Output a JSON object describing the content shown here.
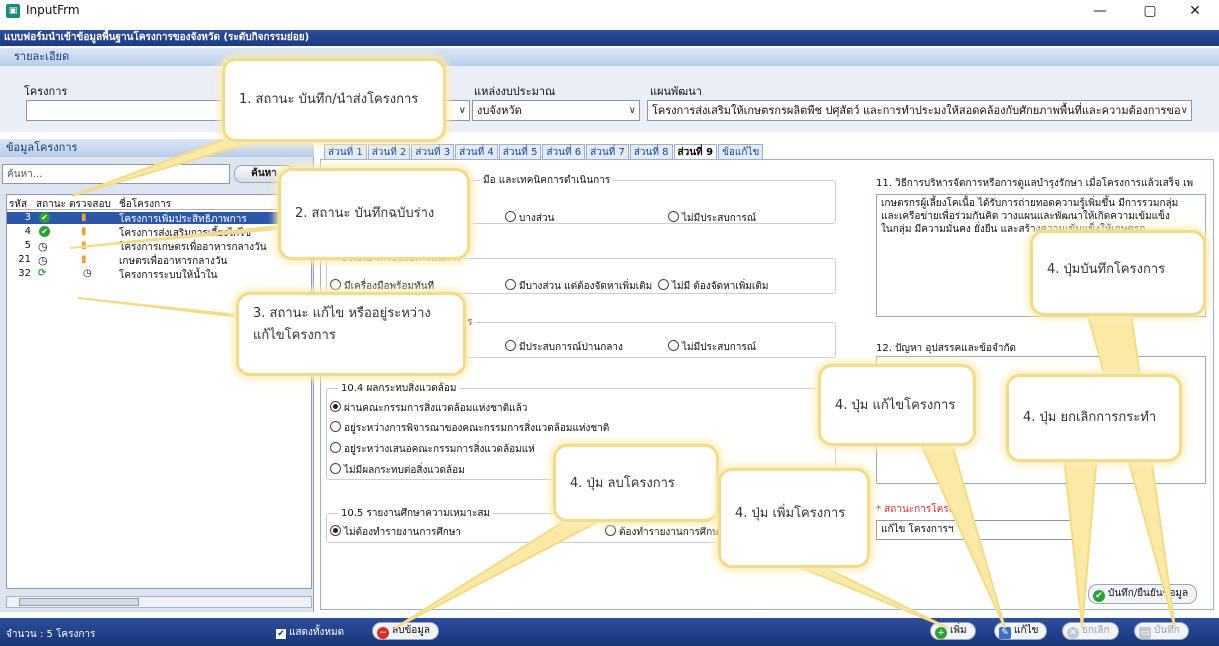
{
  "window": {
    "title": "InputFrm",
    "minimize": "—",
    "maximize": "▢",
    "close": "✕"
  },
  "form_header": "แบบฟอร์มนำเข้าข้อมูลพื้นฐานโครงการของจังหวัด (ระดับกิจกรรมย่อย)",
  "detail": {
    "header": "รายละเอียด",
    "project_label": "โครงการ",
    "project_value": "",
    "budget_source_label": "แหล่งงบประมาณ",
    "budget_source_value": "งบจังหวัด",
    "plan_label": "แผนพัฒนา",
    "plan_value": "โครงการส่งเสริมให้เกษตรกรผลิตพืช ปศุสัตว์ และการทำประมงให้สอดคล้องกับศักยภาพพื้นที่และความต้องการขอ"
  },
  "left_panel": {
    "header": "ข้อมูลโครงการ",
    "search_placeholder": "ค้นหา...",
    "search_button": "ค้นหา",
    "columns": [
      "รหัส",
      "สถานะ",
      "ตรวจสอบ",
      "ชื่อโครงการ"
    ],
    "rows": [
      {
        "id": "3",
        "status": "saved",
        "name": "โครงการเพิ่มประสิทธิภาพการ"
      },
      {
        "id": "4",
        "status": "saved",
        "name": "โครงการส่งเสริมการเลี้ยงไก่ไข่"
      },
      {
        "id": "5",
        "status": "draft",
        "name": "โครงการเกษตรเพื่ออาหารกลางวัน"
      },
      {
        "id": "21",
        "status": "draft",
        "name": "เกษตรเพื่ออาหารกลางวัน"
      },
      {
        "id": "32",
        "status": "editing",
        "name": "โครงการระบบให้น้ำใน"
      }
    ],
    "count_text": "จำนวน : 5 โครงการ",
    "show_all": "แสดงทั้งหมด"
  },
  "tabs": [
    "ส่วนที่ 1",
    "ส่วนที่ 2",
    "ส่วนที่ 3",
    "ส่วนที่ 4",
    "ส่วนที่ 5",
    "ส่วนที่ 6",
    "ส่วนที่ 7",
    "ส่วนที่ 8",
    "ส่วนที่ 9",
    "ข้อแก้ไข"
  ],
  "active_tab": "ส่วนที่ 9",
  "section": {
    "s1_title": "มือ และเทคนิคการดำเนินการ",
    "s1_opt2": "บางส่วน",
    "s1_opt3": "ไม่มีประสบการณ์",
    "s2_title": "10.3.2 เครื่องมือดำเนินการ",
    "s2_opt1": "มีเครื่องมือพร้อมทันที",
    "s2_opt2": "มีบางส่วน แต่ต้องจัดหาเพิ่มเติม",
    "s2_opt3": "ไม่มี ต้องจัดหาเพิ่มเติม",
    "s3_title": "จัดการ",
    "s3_opt2": "มีประสบการณ์ปานกลาง",
    "s3_opt3": "ไม่มีประสบการณ์",
    "env_title": "10.4 ผลกระทบสิ่งแวดล้อม",
    "env_opts": [
      "ผ่านคณะกรรมการสิ่งแวดล้อมแห่งชาติแล้ว",
      "อยู่ระหว่างการพิจารณาของคณะกรรมการสิ่งแวดล้อมแห่งชาติ",
      "อยู่ระหว่างเสนอคณะกรรมการสิ่งแวดล้อมแห่",
      "ไม่มีผลกระทบต่อสิ่งแวดล้อม"
    ],
    "study_title": "10.5 รายงานศึกษาความเหมาะสม",
    "study_opt1": "ไม่ต้องทำรายงานการศึกษา",
    "study_opt2": "ต้องทำรายงานการศึกษา",
    "q11_title": "11. วิธีการบริหารจัดการหรือการดูแลบำรุงรักษา เมื่อโครงการแล้วเสร็จ เพ",
    "q11_text": "เกษตรกรผู้เลี้ยงโคเนื้อ ได้รับการถ่ายทอดความรู้เพิ่มขึ้น มีการรวมกลุ่มและเครือข่ายเพื่อร่วมกันคิด วางแผนและพัฒนาให้เกิดความเข้มแข็งในกลุ่ม มีความมั่นคง ยั่งยืน และสร้างความเข้มแข็งให้เกษตรก",
    "q12_title": "12. ปัญหา อุปสรรคและข้อจำกัด",
    "status_label": "* สถานะการโครงการ",
    "status_value": "แก้ไข โครงการฯ",
    "confirm_button": "บันทึก/ยืนยันข้อมูล"
  },
  "bottom": {
    "delete_button": "ลบข้อมูล",
    "add_button": "เพิ่ม",
    "edit_button": "แก้ไข",
    "cancel_button": "ยกเลิก",
    "save_button": "บันทึก"
  },
  "callouts": {
    "c1": "1. สถานะ บันทึก/นำส่งโครงการ",
    "c2": "2. สถานะ บันทึกฉบับร่าง",
    "c3": "3. สถานะ แก้ไข หรืออยู่ระหว่าง\nแก้ไขโครงการ",
    "c4_save": "4. ปุ่มบันทึกโครงการ",
    "c4_edit": "4. ปุ่ม แก้ไขโครงการ",
    "c4_cancel": "4. ปุ่ม ยกเลิกการกระทำ",
    "c4_delete": "4. ปุ่ม ลบโครงการ",
    "c4_add": "4. ปุ่ม เพิ่มโครงการ"
  },
  "colors": {
    "header_blue": "#1b3a84",
    "highlight": "#f2dc89",
    "ok_green": "#2e9d3a",
    "delete_red": "#d32f2f"
  }
}
